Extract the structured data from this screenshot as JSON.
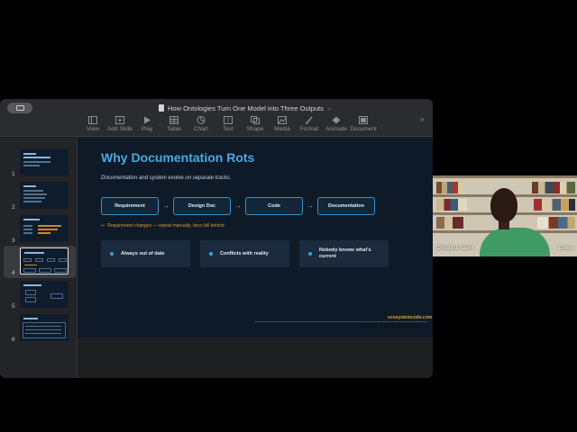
{
  "window": {
    "doc_title": "How Ontologies Turn One Model into Three Outputs",
    "toolbar": [
      {
        "label": "View",
        "icon": "view-icon"
      },
      {
        "label": "Add Slide",
        "icon": "add-slide-icon"
      },
      {
        "label": "Play",
        "icon": "play-icon"
      },
      {
        "label": "Table",
        "icon": "table-icon"
      },
      {
        "label": "Chart",
        "icon": "chart-icon"
      },
      {
        "label": "Text",
        "icon": "text-icon"
      },
      {
        "label": "Shape",
        "icon": "shape-icon"
      },
      {
        "label": "Media",
        "icon": "media-icon"
      },
      {
        "label": "Format",
        "icon": "format-icon"
      },
      {
        "label": "Animate",
        "icon": "animate-icon"
      },
      {
        "label": "Document",
        "icon": "document-icon"
      }
    ],
    "overflow": "»"
  },
  "navigator": {
    "slides": [
      {
        "number": "1",
        "selected": false
      },
      {
        "number": "2",
        "selected": false
      },
      {
        "number": "3",
        "selected": false
      },
      {
        "number": "4",
        "selected": true
      },
      {
        "number": "5",
        "selected": false
      },
      {
        "number": "6",
        "selected": false
      }
    ]
  },
  "slide": {
    "title": "Why Documentation Rots",
    "subtitle": "Documentation and system evolve on separate tracks.",
    "flow": [
      "Requirement",
      "Design Doc",
      "Code",
      "Documentation"
    ],
    "arrow": "→",
    "note_icon": "↩",
    "note": "Requirement changes — repeat manually, docs fall behind",
    "cards": [
      "Always out of date",
      "Conflicts with reality",
      "Nobody knows what's current"
    ],
    "footer_url": "ecosystemcode.com",
    "footer_ghost": "ECOSYSTEMCODE"
  },
  "webcam": {
    "name": "Christina Yasini",
    "right_label": "Ecosys"
  },
  "colors": {
    "accent": "#4aa8e0",
    "note": "#d69a3a",
    "slide_bg": "#0f1a28"
  }
}
